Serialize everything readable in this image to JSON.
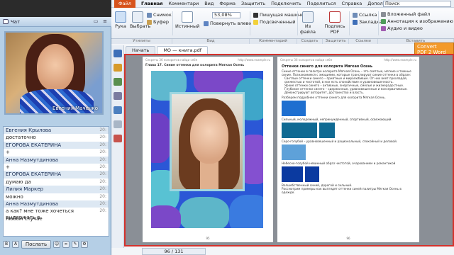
{
  "chat": {
    "title": "Чат",
    "video_name": "Евгения Маченко",
    "messages": [
      {
        "text": "Евгения Крылова",
        "author": true,
        "time": "20:"
      },
      {
        "text": "достаточно",
        "author": false,
        "time": "20:"
      },
      {
        "text": "ЕГОРОВА ЕКАТЕРИНА",
        "author": true,
        "time": "20:"
      },
      {
        "text": "+",
        "author": false,
        "time": "20:"
      },
      {
        "text": "Анна Назмутдинова",
        "author": true,
        "time": "20:"
      },
      {
        "text": "+",
        "author": false,
        "time": "20:"
      },
      {
        "text": "ЕГОРОВА ЕКАТЕРИНА",
        "author": true,
        "time": "20:"
      },
      {
        "text": "думаю да",
        "author": false,
        "time": "20:"
      },
      {
        "text": "Лилия Маркер",
        "author": true,
        "time": "20:"
      },
      {
        "text": "можно",
        "author": false,
        "time": "20:"
      },
      {
        "text": "Анна Назмутдинова",
        "author": true,
        "time": "20:"
      },
      {
        "text": "а как? мне тоже хочеться выдержать в",
        "author": false,
        "time": "20:"
      },
      {
        "text": "любом случае",
        "author": false,
        "time": ""
      }
    ],
    "send_label": "Послать"
  },
  "menu": {
    "file": "Файл",
    "items": [
      "Главная",
      "Комментари",
      "Вид",
      "Форма",
      "Защитить",
      "Подключить",
      "Поделиться",
      "Справка",
      "Дополнител"
    ],
    "search_placeholder": "Поиск"
  },
  "ribbon": {
    "hand": "Рука",
    "select": "Выбрать",
    "snapshot": "Снимок",
    "clipboard": "Буфер",
    "actual": "Истинный",
    "zoom": "53,08%",
    "rotate": "Повернуть влево",
    "typewriter": "Пишущая машинка",
    "highlight": "Подсвеченный",
    "from": "Из файла",
    "sign": "Подпись PDF",
    "link": "Ссылка",
    "bookmark": "Закладка",
    "attach": "Вложенный файл",
    "image_note": "Аннотация к изображению",
    "audio": "Аудио и видео"
  },
  "groups": [
    "Утилиты",
    "Вид",
    "Комментарий",
    "Создать",
    "Защитить",
    "Ссылки",
    "Вставить"
  ],
  "tabs": [
    {
      "label": "Начать",
      "active": false
    },
    {
      "label": "МО — книга.pdf",
      "active": true
    }
  ],
  "convert": {
    "line1": "Convert",
    "line2": "PDF 2 Word"
  },
  "page1": {
    "header_left": "Секреты 36 колоритов найди себя",
    "header_right": "http://www.example.ru",
    "chapter": "Глава 17. Синие оттенки для колорита Мягкая Осень",
    "number": "95"
  },
  "page2": {
    "header_left": "Секреты 36 колоритов найди себя",
    "header_right": "http://www.example.ru",
    "heading": "Оттенки синего для колорита Мягкая Осень",
    "intro": "Синие оттенки в палитре колорита Мягкая Осень – это светлые, мягкие и темные синие. Познакомимся с эмоциями, которые транслируют синие оттенки в образе:",
    "bullets": [
      "Светлые оттенки синего – приятные и миролюбивые. От них веет прохладой, свежестью и чистотой, в них есть спокойствие и уравновешенность.",
      "Яркие оттенки синего – активные, энергичные, смелые и жизнерадостные.",
      "Глубокие оттенки синего – сдержанные, уравновешенные и консервативные. Демонстрируют авторитет, достоинство и власть."
    ],
    "section": "Разберем подробнее оттенки синего для колорита Мягкая Осень.",
    "caption1": "Сильный, молодежный, непринужденный, спортивный, освежающий.",
    "caption2": "Серо-голубой – уравновешенный и рациональный, спокойный и деловой.",
    "caption3": "Небесно-голубой невинный образ чистотой, очарованием и романтикой",
    "caption4": "Волшебственный синий, дорогой и сильный.",
    "footer": "Рассмотрим примеры как выглядят оттенки синей палитры Мягкая Осень в одежде.",
    "number": "96"
  },
  "page_control": "96 / 131",
  "colors": {
    "file_tab": "#d7531c",
    "convert": "#f39a2b",
    "doc_border": "#d4312c",
    "blue1": "#1e6fd0",
    "blue2": "#0f6a93",
    "blue3": "#5ea1d9",
    "blue4": "#0b3aa0"
  }
}
